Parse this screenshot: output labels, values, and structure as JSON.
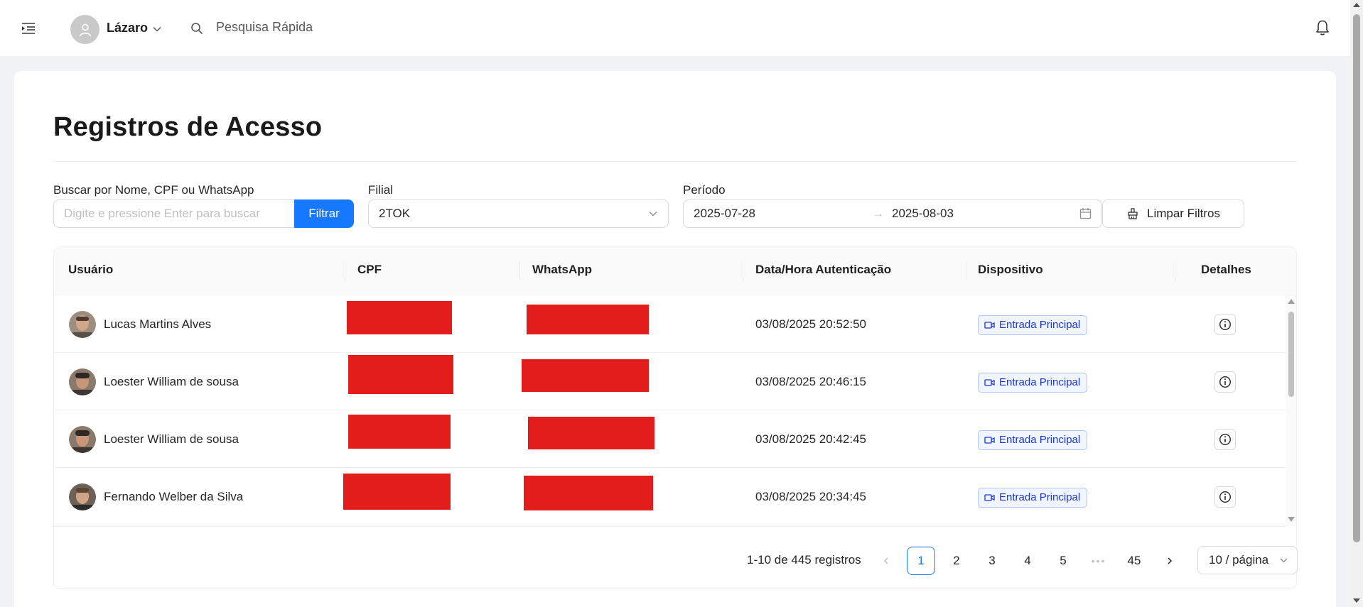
{
  "header": {
    "user_name": "Lázaro",
    "search_placeholder": "Pesquisa Rápida"
  },
  "page": {
    "title": "Registros de Acesso"
  },
  "filters": {
    "search_label": "Buscar por Nome, CPF ou WhatsApp",
    "search_placeholder": "Digite e pressione Enter para buscar",
    "filter_button": "Filtrar",
    "branch_label": "Filial",
    "branch_value": "2TOK",
    "period_label": "Período",
    "period_start": "2025-07-28",
    "period_arrow": "→",
    "period_end": "2025-08-03",
    "clear_button": "Limpar Filtros"
  },
  "table": {
    "columns": [
      "Usuário",
      "CPF",
      "WhatsApp",
      "Data/Hora Autenticação",
      "Dispositivo",
      "Detalhes"
    ],
    "rows": [
      {
        "name": "Lucas Martins Alves",
        "datetime": "03/08/2025 20:52:50",
        "device": "Entrada Principal"
      },
      {
        "name": "Loester William de sousa",
        "datetime": "03/08/2025 20:46:15",
        "device": "Entrada Principal"
      },
      {
        "name": "Loester William de sousa",
        "datetime": "03/08/2025 20:42:45",
        "device": "Entrada Principal"
      },
      {
        "name": "Fernando Welber da Silva",
        "datetime": "03/08/2025 20:34:45",
        "device": "Entrada Principal"
      }
    ]
  },
  "pagination": {
    "total_text": "1-10 de 445 registros",
    "pages": [
      "1",
      "2",
      "3",
      "4",
      "5"
    ],
    "ellipsis": "•••",
    "last_page": "45",
    "current_page": "1",
    "page_size": "10 / página"
  },
  "colors": {
    "primary": "#1677ff",
    "redaction": "#e31c1c",
    "tag_border": "#adc6ff",
    "tag_text": "#1d39c4"
  }
}
